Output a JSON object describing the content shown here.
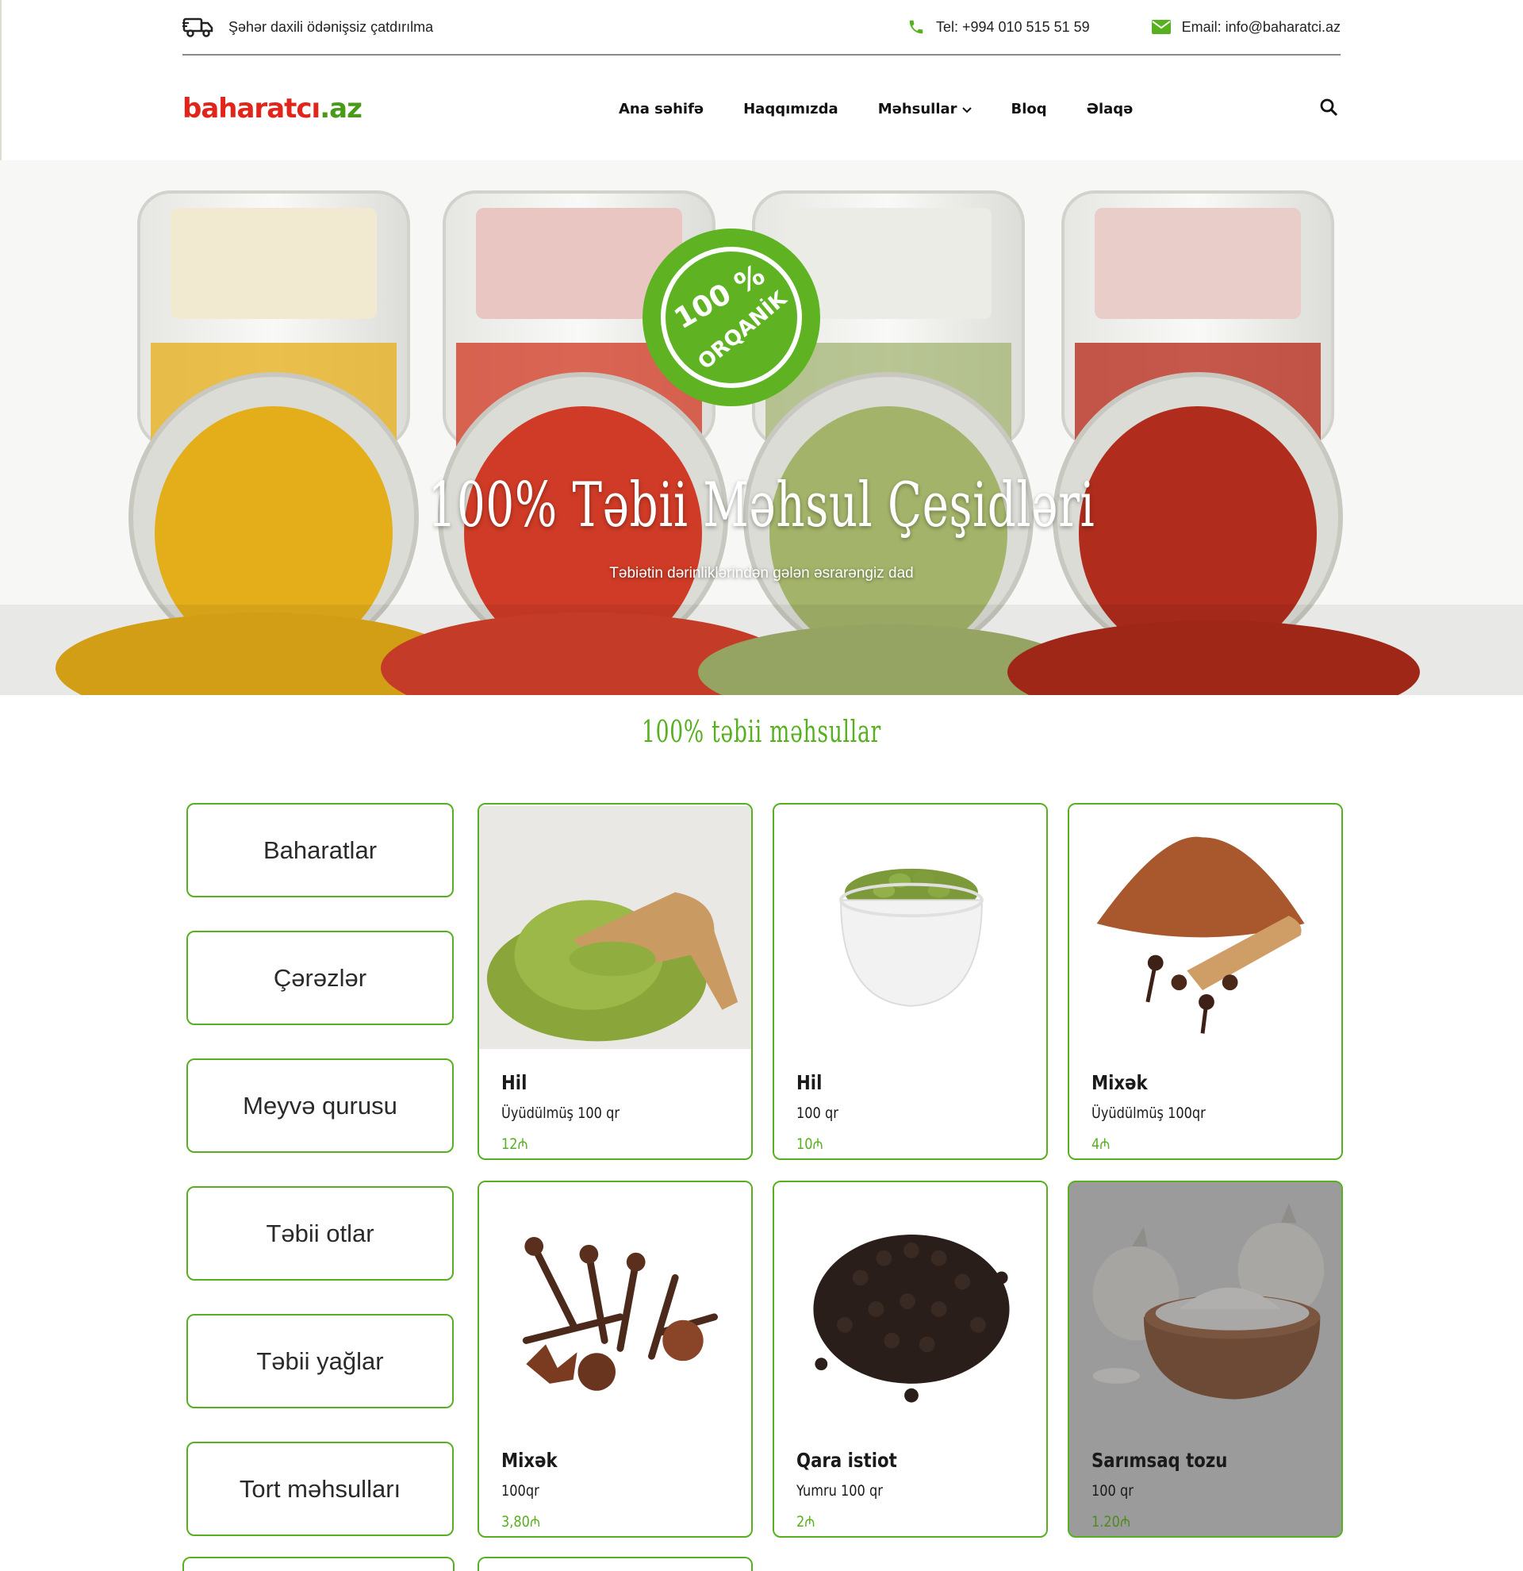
{
  "topbar": {
    "delivery_text": "Şəhər daxili ödənişsiz çatdırılma",
    "phone_text": "Tel: +994 010 515 51 59",
    "email_text": "Email: info@baharatci.az"
  },
  "header": {
    "logo_red": "baharatcı",
    "logo_green": ".az",
    "nav": {
      "home": "Ana səhifə",
      "about": "Haqqımızda",
      "products": "Məhsullar",
      "blog": "Bloq",
      "contact": "Əlaqə"
    }
  },
  "hero": {
    "badge_top": "100 %",
    "badge_bottom": "ORQANİK",
    "title": "100% Təbii Məhsul Çeşidləri",
    "subtitle": "Təbiətin dərinliklərindən gələn əsrarəngiz dad"
  },
  "section": {
    "title": "100% təbii məhsullar"
  },
  "categories": [
    "Baharatlar",
    "Çərəzlər",
    "Meyvə qurusu",
    "Təbii otlar",
    "Təbii yağlar",
    "Tort məhsulları"
  ],
  "products": [
    {
      "name": "Hil",
      "desc": "Üyüdülmüş 100 qr",
      "price": "12₼"
    },
    {
      "name": "Hil",
      "desc": "100 qr",
      "price": "10₼"
    },
    {
      "name": "Mixək",
      "desc": "Üyüdülmüş 100qr",
      "price": "4₼"
    },
    {
      "name": "Mixək",
      "desc": "100qr",
      "price": "3,80₼"
    },
    {
      "name": "Qara istiot",
      "desc": "Yumru 100 qr",
      "price": "2₼"
    },
    {
      "name": "Sarımsaq tozu",
      "desc": "100 qr",
      "price": "1.20₼"
    }
  ],
  "colors": {
    "brand_green": "#58b021",
    "brand_red": "#e1251b",
    "text_dark": "#1a1a1a"
  }
}
